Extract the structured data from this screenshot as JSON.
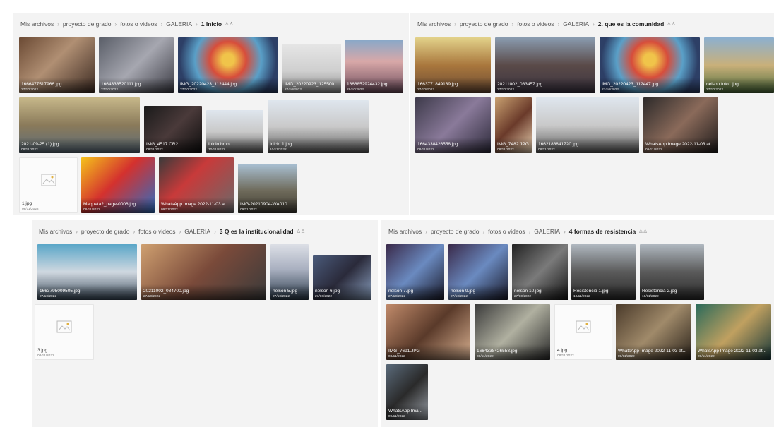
{
  "panels": [
    {
      "breadcrumb": [
        "Mis archivos",
        "proyecto de grado",
        "fotos o videos",
        "GALERIA",
        "1 Inicio"
      ],
      "tiles": [
        {
          "name": "1666477517966.jpg",
          "date": "27/10/2022"
        },
        {
          "name": "1664338520111.jpg",
          "date": "27/10/2022"
        },
        {
          "name": "IMG_20220423_112444.jpg",
          "date": "27/10/2022"
        },
        {
          "name": "IMG_20220923_125500...",
          "date": "27/10/2022"
        },
        {
          "name": "1666852924432.jpg",
          "date": "28/10/2022"
        },
        {
          "name": "2021-09-25 (1).jpg",
          "date": "08/11/2022"
        },
        {
          "name": "IMG_4517.CR2",
          "date": "08/11/2022"
        },
        {
          "name": "Inicio.bmp",
          "date": "10/11/2022"
        },
        {
          "name": "Inicio 1.jpg",
          "date": "10/11/2022"
        },
        {
          "name": "1.jpg",
          "date": "08/11/2022"
        },
        {
          "name": "Maqueta2_page-0006.jpg",
          "date": "08/11/2022"
        },
        {
          "name": "WhatsApp Image 2022-11-03 at...",
          "date": "09/11/2022"
        },
        {
          "name": "IMG-20210904-WA010...",
          "date": "09/11/2022"
        }
      ]
    },
    {
      "breadcrumb": [
        "Mis archivos",
        "proyecto de grado",
        "fotos o videos",
        "GALERIA",
        "2. que es la comunidad"
      ],
      "tiles": [
        {
          "name": "1663771849139.jpg",
          "date": "27/10/2022"
        },
        {
          "name": "20211002_083457.jpg",
          "date": "27/10/2022"
        },
        {
          "name": "IMG_20220423_112447.jpg",
          "date": "27/10/2022"
        },
        {
          "name": "nelson foto1.jpg",
          "date": "27/10/2022"
        },
        {
          "name": "1664338426558.jpg",
          "date": "08/11/2022"
        },
        {
          "name": "IMG_7482.JPG",
          "date": "08/11/2022"
        },
        {
          "name": "1662188841720.jpg",
          "date": "08/11/2022"
        },
        {
          "name": "WhatsApp Image 2022-11-03 at...",
          "date": "09/11/2022"
        }
      ]
    },
    {
      "breadcrumb": [
        "Mis archivos",
        "proyecto de grado",
        "fotos o videos",
        "GALERIA",
        "3 Q es la institucionalidad"
      ],
      "tiles": [
        {
          "name": "1663795009505.jpg",
          "date": "27/10/2022"
        },
        {
          "name": "20211002_084700.jpg",
          "date": "27/10/2022"
        },
        {
          "name": "nelson 5.jpg",
          "date": "27/10/2022"
        },
        {
          "name": "nelson 6.jpg",
          "date": "27/10/2022"
        },
        {
          "name": "3.jpg",
          "date": "08/11/2022"
        }
      ]
    },
    {
      "breadcrumb": [
        "Mis archivos",
        "proyecto de grado",
        "fotos o videos",
        "GALERIA",
        "4 formas de resistencia"
      ],
      "tiles": [
        {
          "name": "nelson 7.jpg",
          "date": "27/10/2022"
        },
        {
          "name": "nelson 9.jpg",
          "date": "27/10/2022"
        },
        {
          "name": "nelson 10.jpg",
          "date": "27/10/2022"
        },
        {
          "name": "Resistencia 1.jpg",
          "date": "10/11/2022"
        },
        {
          "name": "Resistencia 2.jpg",
          "date": "10/11/2022"
        },
        {
          "name": "IMG_7691.JPG",
          "date": "08/11/2022"
        },
        {
          "name": "1664338426558.jpg",
          "date": "08/11/2022"
        },
        {
          "name": "4.jpg",
          "date": "08/11/2022"
        },
        {
          "name": "WhatsApp Image 2022-11-03 at...",
          "date": "09/11/2022"
        },
        {
          "name": "WhatsApp Image 2022-11-03 at...",
          "date": "09/11/2022"
        },
        {
          "name": "WhatsApp Ima...",
          "date": "09/11/2022"
        }
      ]
    }
  ]
}
